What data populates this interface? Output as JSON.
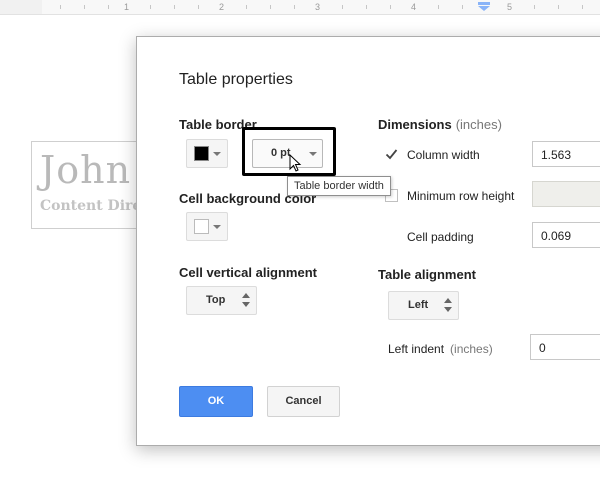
{
  "ruler": {
    "numbers": [
      "1",
      "2",
      "3",
      "4",
      "5"
    ]
  },
  "document": {
    "name": "John",
    "subtitle": "Content Dire"
  },
  "dialog": {
    "title": "Table properties",
    "table_border": {
      "label": "Table border",
      "color": "#000000",
      "width_value": "0 pt",
      "tooltip": "Table border width"
    },
    "cell_background": {
      "label": "Cell background color",
      "color": "#ffffff"
    },
    "cell_vertical_alignment": {
      "label": "Cell vertical alignment",
      "value": "Top"
    },
    "dimensions": {
      "label": "Dimensions",
      "unit": "(inches)",
      "column_width": {
        "label": "Column width",
        "checked": true,
        "value": "1.563"
      },
      "min_row_height": {
        "label": "Minimum row height",
        "checked": false,
        "value": ""
      },
      "cell_padding": {
        "label": "Cell padding",
        "value": "0.069"
      }
    },
    "table_alignment": {
      "label": "Table alignment",
      "value": "Left",
      "left_indent": {
        "label": "Left indent",
        "unit": "(inches)",
        "value": "0"
      }
    },
    "buttons": {
      "ok": "OK",
      "cancel": "Cancel"
    }
  },
  "colors": {
    "accent": "#4d8ef2",
    "highlight_border": "#000000"
  }
}
